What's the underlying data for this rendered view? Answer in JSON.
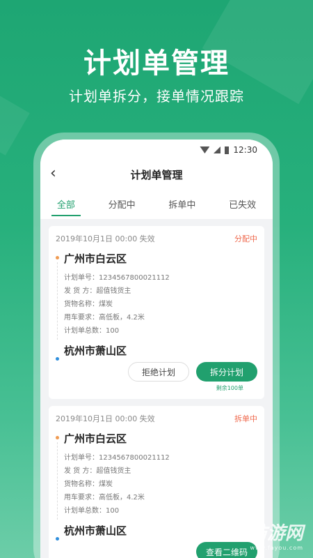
{
  "hero": {
    "title": "计划单管理",
    "subtitle": "计划单拆分，接单情况跟踪"
  },
  "statusbar": {
    "time": "12:30"
  },
  "navbar": {
    "back_icon": "‹",
    "title": "计划单管理"
  },
  "tabs": [
    {
      "label": "全部",
      "active": true
    },
    {
      "label": "分配中",
      "active": false
    },
    {
      "label": "拆单中",
      "active": false
    },
    {
      "label": "已失效",
      "active": false
    }
  ],
  "cards": [
    {
      "date": "2019年10月1日  00:00 失效",
      "status": "分配中",
      "from": "广州市白云区",
      "to": "杭州市萧山区",
      "details": [
        "计划单号：1234567800021112",
        "发  货  方：超值钱货主",
        "货物名称：煤炭",
        "用车要求：高低板，4.2米",
        "计划单总数：100"
      ],
      "btn_reject": "拒绝计划",
      "btn_split": "拆分计划",
      "remain": "剩余100单"
    },
    {
      "date": "2019年10月1日  00:00 失效",
      "status": "拆单中",
      "from": "广州市白云区",
      "to": "杭州市萧山区",
      "details": [
        "计划单号：1234567800021112",
        "发  货  方：超值钱货主",
        "货物名称：煤炭",
        "用车要求：高低板，4.2米",
        "计划单总数：100"
      ],
      "btn_view": "查看二维码"
    }
  ],
  "watermark": {
    "main": "仿游网",
    "url": "www.fayou.com"
  },
  "colors": {
    "accent": "#21a06e",
    "status": "#ef6a4e"
  }
}
